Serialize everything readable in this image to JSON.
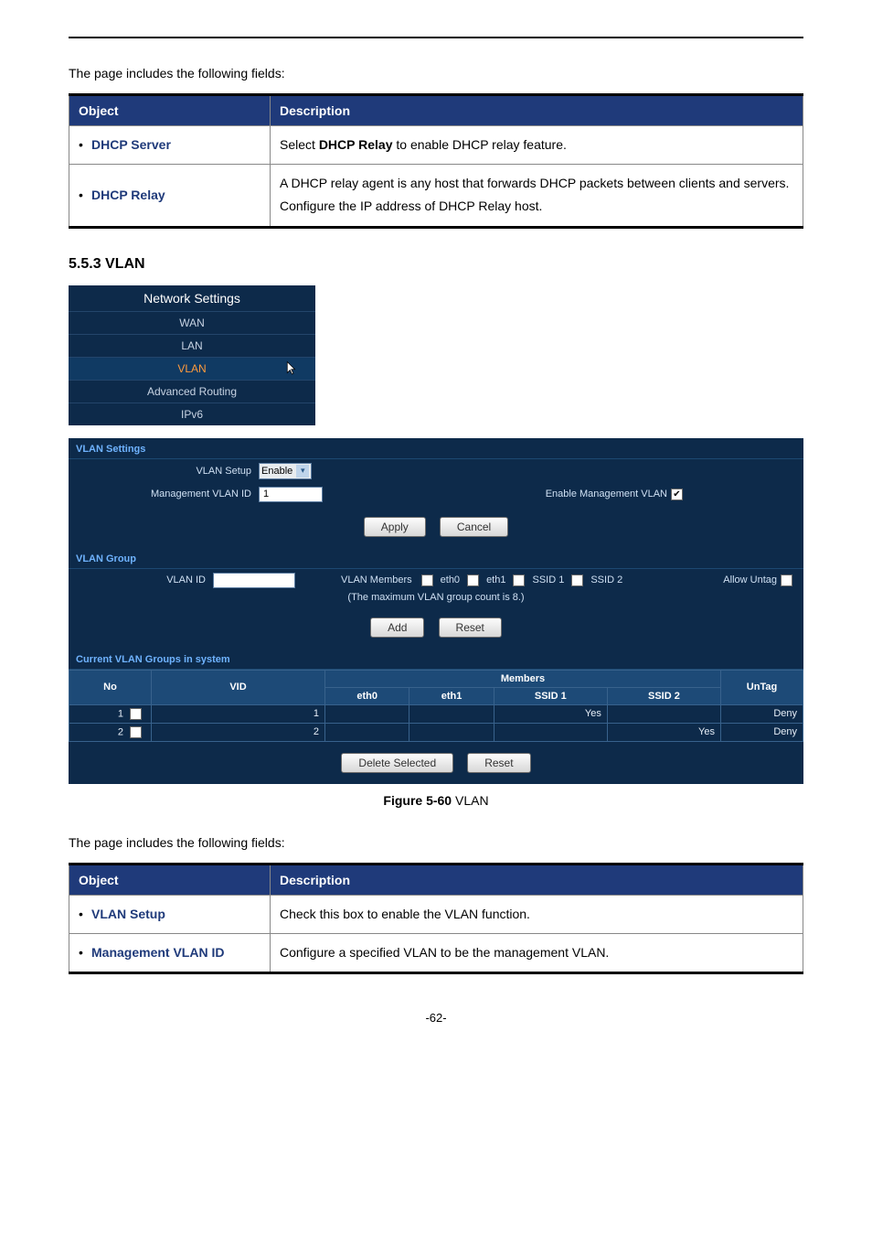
{
  "intro1": "The page includes the following fields:",
  "intro2": "The page includes the following fields:",
  "table1": {
    "head_object": "Object",
    "head_desc": "Description",
    "rows": [
      {
        "obj": "DHCP Server",
        "desc_pre": "Select ",
        "desc_bold": "DHCP Relay",
        "desc_post": " to enable DHCP relay feature."
      },
      {
        "obj": "DHCP Relay",
        "desc_l1": "A DHCP relay agent is any host that forwards DHCP packets between clients and servers.",
        "desc_l2": "Configure the IP address of DHCP Relay host."
      }
    ]
  },
  "section_heading": "5.5.3  VLAN",
  "nav": {
    "title": "Network Settings",
    "items": [
      "WAN",
      "LAN",
      "VLAN",
      "Advanced Routing",
      "IPv6"
    ],
    "active": "VLAN"
  },
  "vlan_panel": {
    "settings_title": "VLAN Settings",
    "setup_label": "VLAN Setup",
    "setup_value": "Enable",
    "mgmt_id_label": "Management VLAN ID",
    "mgmt_id_value": "1",
    "enable_mgmt_label": "Enable Management VLAN",
    "enable_mgmt_checked": true,
    "btn_apply": "Apply",
    "btn_cancel": "Cancel",
    "group_title": "VLAN Group",
    "vlan_id_label": "VLAN ID",
    "members_label": "VLAN Members",
    "members": [
      "eth0",
      "eth1",
      "SSID 1",
      "SSID 2"
    ],
    "allow_untag_label": "Allow Untag",
    "note": "(The maximum VLAN group count is 8.)",
    "btn_add": "Add",
    "btn_reset": "Reset",
    "current_title": "Current VLAN Groups in system",
    "grp_headers": {
      "no": "No",
      "vid": "VID",
      "members": "Members",
      "cols": [
        "eth0",
        "eth1",
        "SSID 1",
        "SSID 2"
      ],
      "untag": "UnTag"
    },
    "grp_rows": [
      {
        "no": "1",
        "vid": "1",
        "eth0": "",
        "eth1": "",
        "ssid1": "Yes",
        "ssid2": "",
        "untag": "Deny"
      },
      {
        "no": "2",
        "vid": "2",
        "eth0": "",
        "eth1": "",
        "ssid1": "",
        "ssid2": "Yes",
        "untag": "Deny"
      }
    ],
    "btn_delete": "Delete Selected",
    "btn_reset2": "Reset"
  },
  "figure_caption_bold": "Figure 5-60",
  "figure_caption_rest": " VLAN",
  "table2": {
    "head_object": "Object",
    "head_desc": "Description",
    "rows": [
      {
        "obj": "VLAN Setup",
        "desc": "Check this box to enable the VLAN function."
      },
      {
        "obj": "Management VLAN ID",
        "desc": "Configure a specified VLAN to be the management VLAN."
      }
    ]
  },
  "page_number": "-62-",
  "chart_data": {
    "type": "table",
    "title": "Current VLAN Groups in system",
    "columns": [
      "No",
      "VID",
      "eth0",
      "eth1",
      "SSID 1",
      "SSID 2",
      "UnTag"
    ],
    "rows": [
      [
        1,
        1,
        "",
        "",
        "Yes",
        "",
        "Deny"
      ],
      [
        2,
        2,
        "",
        "",
        "",
        "Yes",
        "Deny"
      ]
    ]
  }
}
